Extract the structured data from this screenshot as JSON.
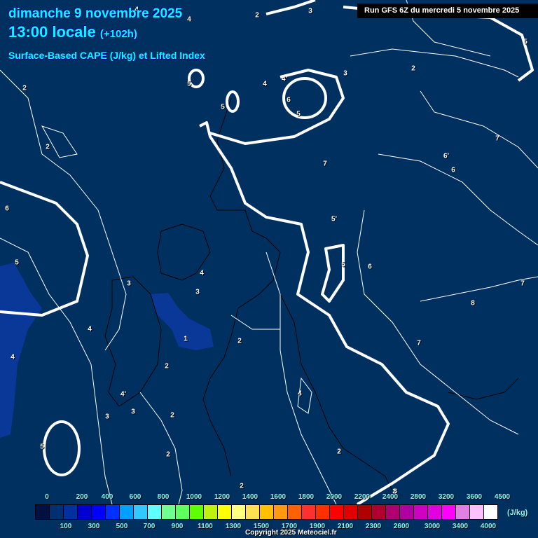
{
  "header": {
    "date": "dimanche 9 novembre 2025",
    "time": "13:00 locale",
    "lead": "(+102h)",
    "parameter": "Surface-Based CAPE (J/kg) et Lifted Index",
    "run": "Run GFS 6Z du mercredi 5 novembre 2025"
  },
  "contour_labels": [
    "2",
    "4",
    "4",
    "2",
    "3",
    "3",
    "2",
    "5",
    "5",
    "4",
    "4'",
    "6",
    "5",
    "5",
    "7",
    "6'",
    "6",
    "2",
    "7",
    "6",
    "5'",
    "5",
    "6",
    "5",
    "4",
    "3",
    "3",
    "2",
    "7",
    "8",
    "7",
    "4",
    "1",
    "2",
    "4",
    "4'",
    "3",
    "3",
    "2",
    "2",
    "4",
    "2",
    "5",
    "2",
    "3",
    "8"
  ],
  "legend": {
    "top_labels": [
      "0",
      "200",
      "400",
      "600",
      "800",
      "1000",
      "1200",
      "1400",
      "1600",
      "1800",
      "2000",
      "2200",
      "2400",
      "2800",
      "3200",
      "3600",
      "4500"
    ],
    "bottom_labels": [
      "100",
      "300",
      "500",
      "700",
      "900",
      "1100",
      "1300",
      "1500",
      "1700",
      "1900",
      "2100",
      "2300",
      "2600",
      "3000",
      "3400",
      "4000"
    ],
    "unit": "(J/kg)",
    "colors": [
      "#001040",
      "#003070",
      "#0030a0",
      "#0000d0",
      "#0000ff",
      "#0030ff",
      "#00a0ff",
      "#30c8ff",
      "#60ffff",
      "#70ff90",
      "#60ff60",
      "#60ff00",
      "#c0f010",
      "#ffff00",
      "#ffff80",
      "#ffe050",
      "#ffc000",
      "#ff9a10",
      "#ff6000",
      "#ff3030",
      "#ff3000",
      "#ff0000",
      "#e00000",
      "#b00000",
      "#b00030",
      "#b00070",
      "#b000a0",
      "#d000c0",
      "#e000e0",
      "#ff00ff",
      "#e080e0",
      "#ffc0ff",
      "#ffffff"
    ]
  },
  "copyright": "Copyright 2025 Meteociel.fr"
}
